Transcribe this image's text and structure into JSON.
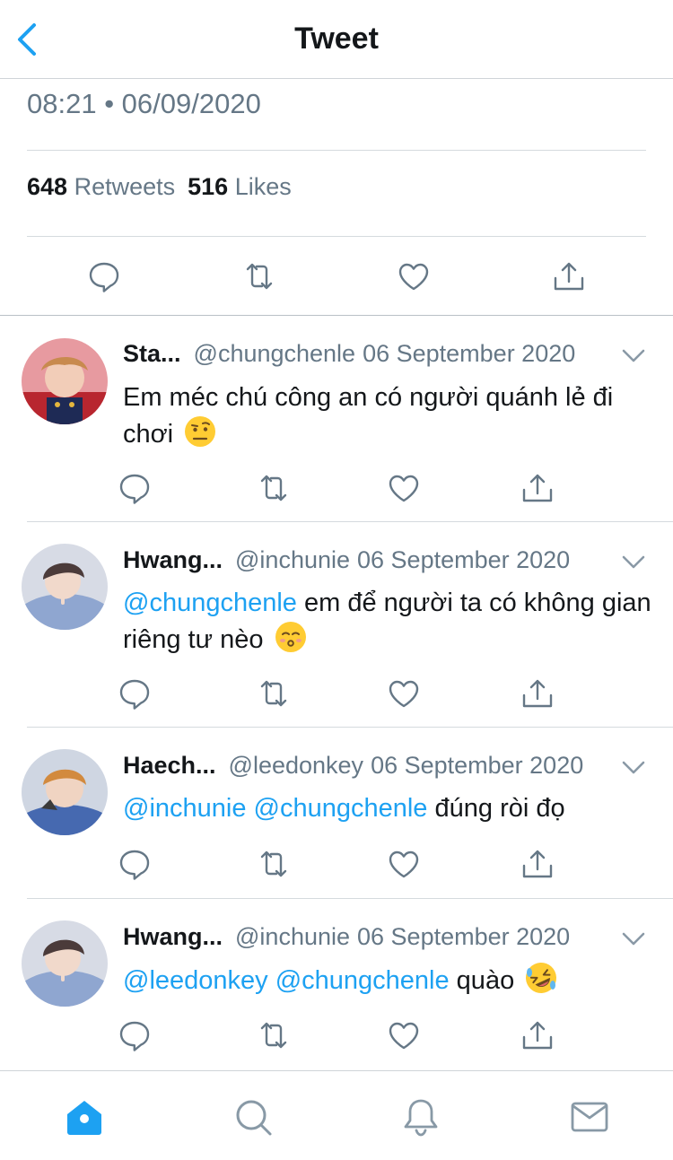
{
  "header": {
    "title": "Tweet",
    "back_icon": "chevron-left-icon"
  },
  "tweet": {
    "timestamp": "08:21 • 06/09/2020",
    "retweets_count": "648",
    "retweets_label": "Retweets",
    "likes_count": "516",
    "likes_label": "Likes",
    "actions": [
      "reply-icon",
      "retweet-icon",
      "like-icon",
      "share-icon"
    ]
  },
  "replies": [
    {
      "name": "Sta...",
      "handle": "@chungchenle",
      "date": "06 September 2020",
      "text": "Em méc chú công an có người quánh lẻ đi chơi",
      "emoji": "face-with-raised-eyebrow-emoji"
    },
    {
      "name": "Hwang...",
      "handle": "@inchunie",
      "date": "06 September 2020",
      "mentions": "@chungchenle",
      "text": " em để người ta có không gian riêng tư nèo",
      "emoji": "kissing-face-emoji"
    },
    {
      "name": "Haech...",
      "handle": "@leedonkey",
      "date": "06 September 2020",
      "mentions": "@inchunie @chungchenle",
      "text": " đúng ròi đọ"
    },
    {
      "name": "Hwang...",
      "handle": "@inchunie",
      "date": "06 September 2020",
      "mentions": "@leedonkey @chungchenle",
      "text": " quào",
      "emoji": "rolling-on-floor-laughing-emoji"
    }
  ],
  "tabbar": {
    "tabs": [
      "home-icon",
      "search-icon",
      "notifications-icon",
      "messages-icon"
    ],
    "active_color": "#1da1f2",
    "inactive_color": "#8899a6"
  },
  "colors": {
    "accent": "#1da1f2",
    "secondary_text": "#657786",
    "icon": "#657786"
  }
}
